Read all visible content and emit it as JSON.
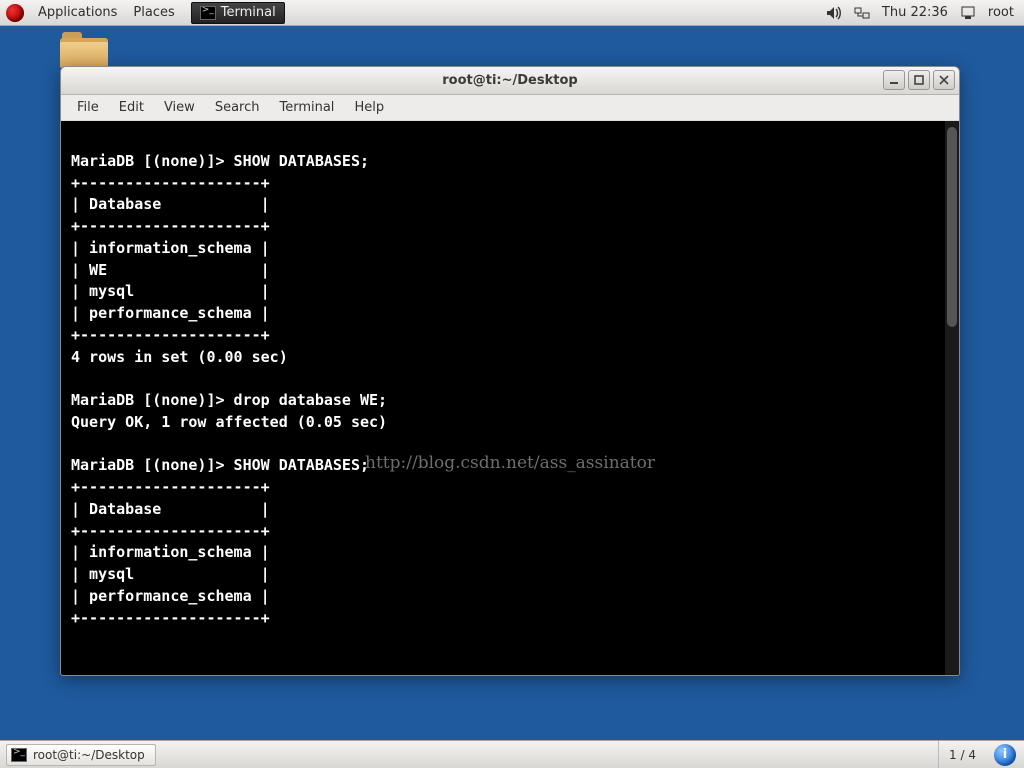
{
  "top_panel": {
    "applications": "Applications",
    "places": "Places",
    "task_label": "Terminal",
    "clock": "Thu 22:36",
    "user": "root"
  },
  "window": {
    "title": "root@ti:~/Desktop",
    "menus": [
      "File",
      "Edit",
      "View",
      "Search",
      "Terminal",
      "Help"
    ]
  },
  "terminal_lines": [
    "",
    "MariaDB [(none)]> SHOW DATABASES;",
    "+--------------------+",
    "| Database           |",
    "+--------------------+",
    "| information_schema |",
    "| WE                 |",
    "| mysql              |",
    "| performance_schema |",
    "+--------------------+",
    "4 rows in set (0.00 sec)",
    "",
    "MariaDB [(none)]> drop database WE;",
    "Query OK, 1 row affected (0.05 sec)",
    "",
    "MariaDB [(none)]> SHOW DATABASES;",
    "+--------------------+",
    "| Database           |",
    "+--------------------+",
    "| information_schema |",
    "| mysql              |",
    "| performance_schema |",
    "+--------------------+"
  ],
  "watermark": "http://blog.csdn.net/ass_assinator",
  "bottom_panel": {
    "task_label": "root@ti:~/Desktop",
    "workspace": "1 / 4"
  }
}
